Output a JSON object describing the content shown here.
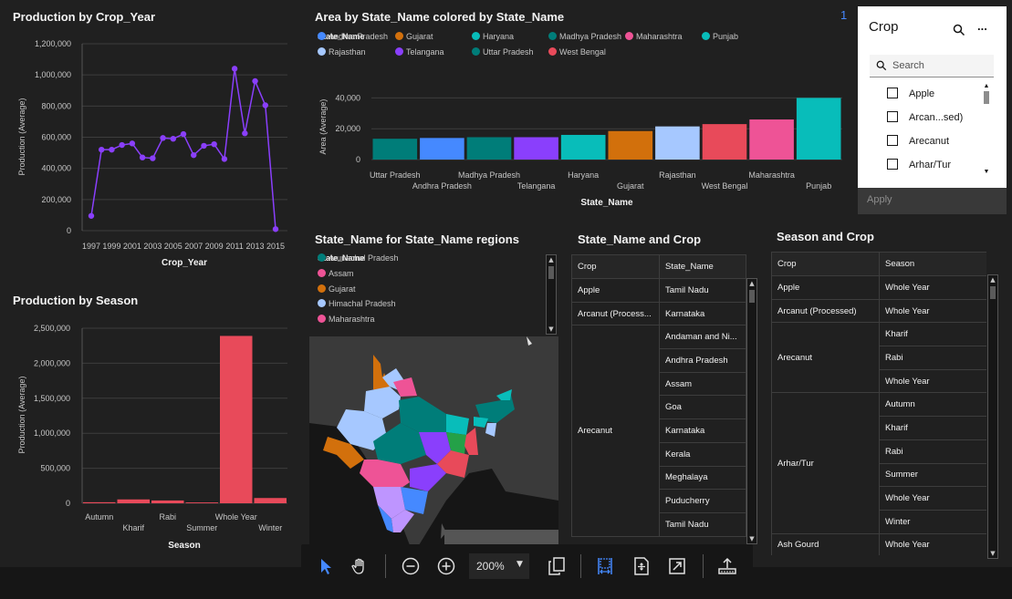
{
  "panels": {
    "prod_year_title": "Production by Crop_Year",
    "prod_season_title": "Production by Season",
    "area_state_title": "Area by State_Name colored by State_Name",
    "state_map_title": "State_Name for State_Name regions",
    "state_crop_title": "State_Name and Crop",
    "season_crop_title": "Season and Crop"
  },
  "chart_data": [
    {
      "type": "line",
      "title": "Production by Crop_Year",
      "xlabel": "Crop_Year",
      "ylabel": "Production (Average)",
      "x": [
        1997,
        1998,
        1999,
        2000,
        2001,
        2002,
        2003,
        2004,
        2005,
        2006,
        2007,
        2008,
        2009,
        2010,
        2011,
        2012,
        2013,
        2014,
        2015
      ],
      "values": [
        95000,
        520000,
        520000,
        550000,
        560000,
        470000,
        465000,
        595000,
        590000,
        620000,
        485000,
        545000,
        555000,
        460000,
        1040000,
        625000,
        960000,
        805000,
        10000
      ],
      "x_ticks": [
        "1997",
        "1999",
        "2001",
        "2003",
        "2005",
        "2007",
        "2009",
        "2011",
        "2013",
        "2015"
      ],
      "y_ticks": [
        "0",
        "200,000",
        "400,000",
        "600,000",
        "800,000",
        "1,000,000",
        "1,200,000"
      ],
      "ylim": [
        0,
        1200000
      ],
      "color": "#8a3ffc"
    },
    {
      "type": "bar",
      "title": "Production by Season",
      "xlabel": "Season",
      "ylabel": "Production (Average)",
      "categories": [
        "Autumn",
        "Kharif",
        "Rabi",
        "Summer",
        "Whole Year",
        "Winter"
      ],
      "values": [
        15000,
        55000,
        40000,
        12000,
        2390000,
        75000
      ],
      "y_ticks": [
        "0",
        "500,000",
        "1,000,000",
        "1,500,000",
        "2,000,000",
        "2,500,000"
      ],
      "ylim": [
        0,
        2500000
      ],
      "color": "#e84a5a"
    },
    {
      "type": "bar",
      "title": "Area by State_Name colored by State_Name",
      "xlabel": "State_Name",
      "ylabel": "Area (Average)",
      "categories": [
        "Uttar Pradesh",
        "Andhra Pradesh",
        "Madhya Pradesh",
        "Telangana",
        "Haryana",
        "Gujarat",
        "Rajasthan",
        "West Bengal",
        "Maharashtra",
        "Punjab"
      ],
      "values": [
        13500,
        14000,
        14500,
        14500,
        16000,
        18500,
        21500,
        23000,
        26000,
        40000
      ],
      "colors": [
        "#007d79",
        "#4589ff",
        "#007d79",
        "#8a3ffc",
        "#08bdba",
        "#d2700c",
        "#a6c8ff",
        "#e84a5a",
        "#ee5396",
        "#08bdba"
      ],
      "y_ticks": [
        "0",
        "20,000",
        "40,000"
      ],
      "ylim": [
        0,
        42000
      ]
    }
  ],
  "area_legend": {
    "title": "State_Name",
    "items": [
      {
        "label": "Andhra Pradesh",
        "color": "#4589ff"
      },
      {
        "label": "Gujarat",
        "color": "#d2700c"
      },
      {
        "label": "Haryana",
        "color": "#08bdba"
      },
      {
        "label": "Madhya Pradesh",
        "color": "#007d79"
      },
      {
        "label": "Maharashtra",
        "color": "#ee5396"
      },
      {
        "label": "Punjab",
        "color": "#08bdba"
      },
      {
        "label": "Rajasthan",
        "color": "#a6c8ff"
      },
      {
        "label": "Telangana",
        "color": "#8a3ffc"
      },
      {
        "label": "Uttar Pradesh",
        "color": "#007d79"
      },
      {
        "label": "West Bengal",
        "color": "#e84a5a"
      }
    ]
  },
  "map_legend": {
    "title": "State_Name",
    "items": [
      {
        "label": "Arunachal Pradesh",
        "color": "#007d79"
      },
      {
        "label": "Assam",
        "color": "#ee5396"
      },
      {
        "label": "Gujarat",
        "color": "#d2700c"
      },
      {
        "label": "Himachal Pradesh",
        "color": "#a6c8ff"
      },
      {
        "label": "Maharashtra",
        "color": "#ee5396"
      }
    ]
  },
  "state_crop_table": {
    "headers": [
      "Crop",
      "State_Name"
    ],
    "rows": [
      {
        "crop": "Apple",
        "states": [
          "Tamil Nadu"
        ]
      },
      {
        "crop": "Arcanut (Process...",
        "states": [
          "Karnataka"
        ]
      },
      {
        "crop": "Arecanut",
        "states": [
          "Andaman and Ni...",
          "Andhra Pradesh",
          "Assam",
          "Goa",
          "Karnataka",
          "Kerala",
          "Meghalaya",
          "Puducherry",
          "Tamil Nadu"
        ]
      }
    ]
  },
  "season_crop_table": {
    "headers": [
      "Crop",
      "Season"
    ],
    "rows": [
      {
        "crop": "Apple",
        "seasons": [
          "Whole Year"
        ]
      },
      {
        "crop": "Arcanut (Processed)",
        "seasons": [
          "Whole Year"
        ]
      },
      {
        "crop": "Arecanut",
        "seasons": [
          "Kharif",
          "Rabi",
          "Whole Year"
        ]
      },
      {
        "crop": "Arhar/Tur",
        "seasons": [
          "Autumn",
          "Kharif",
          "Rabi",
          "Summer",
          "Whole Year",
          "Winter"
        ]
      },
      {
        "crop": "Ash Gourd",
        "seasons": [
          "Whole Year"
        ]
      }
    ]
  },
  "filter": {
    "title": "Crop",
    "badge": "1",
    "search_placeholder": "Search",
    "items": [
      "Apple",
      "Arcan...sed)",
      "Arecanut",
      "Arhar/Tur"
    ],
    "apply": "Apply",
    "more": "..."
  },
  "toolbar": {
    "zoom": "200%"
  },
  "icons": [
    "pointer-icon",
    "pan-hand-icon",
    "zoom-out-icon",
    "zoom-in-icon",
    "copy-icon",
    "fit-width-icon",
    "fit-page-icon",
    "fullscreen-icon",
    "export-icon",
    "search-icon",
    "overflow-icon"
  ]
}
